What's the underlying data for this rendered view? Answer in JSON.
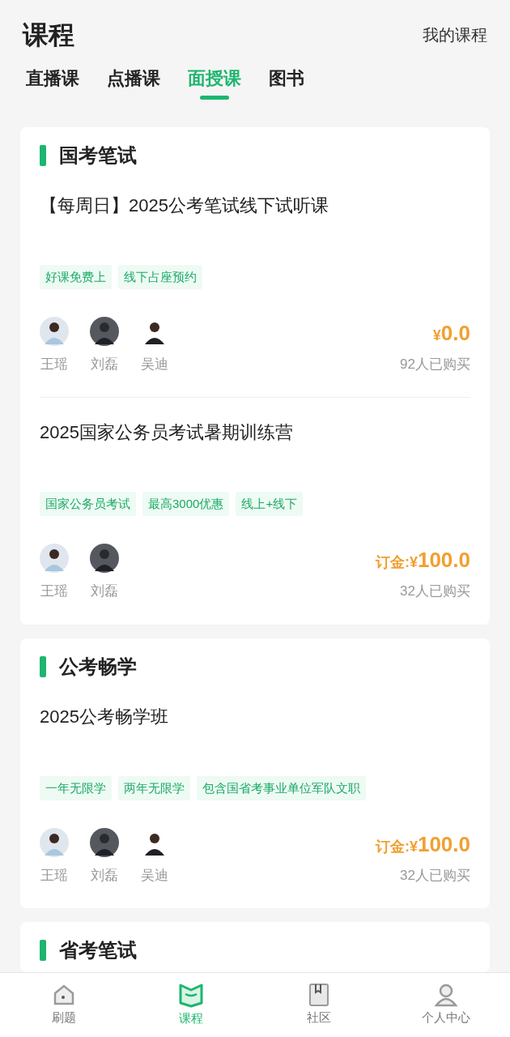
{
  "header": {
    "title": "课程",
    "link": "我的课程"
  },
  "tabs": [
    {
      "label": "直播课",
      "selected": false
    },
    {
      "label": "点播课",
      "selected": false
    },
    {
      "label": "面授课",
      "selected": true
    },
    {
      "label": "图书",
      "selected": false
    }
  ],
  "sections": [
    {
      "title": "国考笔试",
      "courses": [
        {
          "title": "【每周日】2025公考笔试线下试听课",
          "tags": [
            "好课免费上",
            "线下占座预约"
          ],
          "teachers": [
            "王瑶",
            "刘磊",
            "吴迪"
          ],
          "price_prefix": "¥",
          "price": "0.0",
          "sold": "92人已购买"
        },
        {
          "title": "2025国家公务员考试暑期训练营",
          "tags": [
            "国家公务员考试",
            "最高3000优惠",
            "线上+线下"
          ],
          "teachers": [
            "王瑶",
            "刘磊"
          ],
          "price_prefix": "订金:¥",
          "price": "100.0",
          "sold": "32人已购买"
        }
      ]
    },
    {
      "title": "公考畅学",
      "courses": [
        {
          "title": "2025公考畅学班",
          "tags": [
            "一年无限学",
            "两年无限学",
            "包含国省考事业单位军队文职"
          ],
          "teachers": [
            "王瑶",
            "刘磊",
            "吴迪"
          ],
          "price_prefix": "订金:¥",
          "price": "100.0",
          "sold": "32人已购买"
        }
      ]
    },
    {
      "title": "省考笔试"
    }
  ],
  "bottom_nav": [
    {
      "label": "刷题",
      "kind": "home",
      "selected": false
    },
    {
      "label": "课程",
      "kind": "course",
      "selected": true
    },
    {
      "label": "社区",
      "kind": "book",
      "selected": false
    },
    {
      "label": "个人中心",
      "kind": "person",
      "selected": false
    }
  ]
}
